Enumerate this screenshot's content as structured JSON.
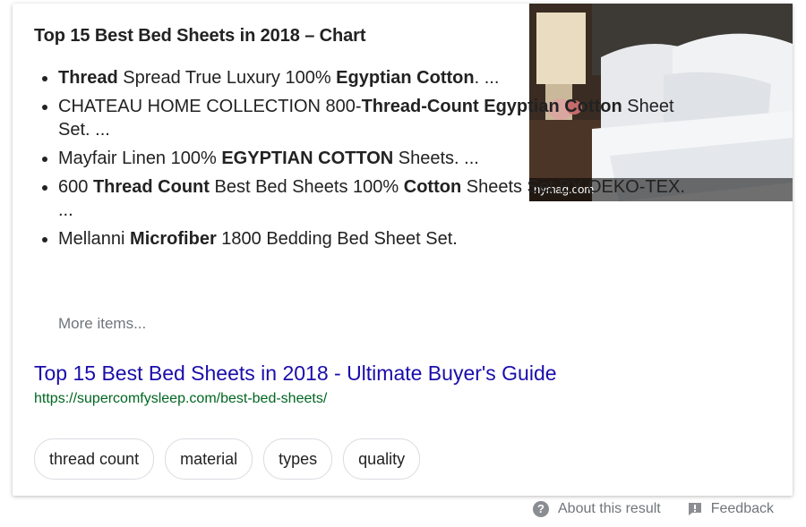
{
  "card": {
    "title": "Top 15 Best Bed Sheets in 2018 – Chart",
    "image_caption": "nymag.com",
    "list": [
      {
        "segments": [
          {
            "t": "Thread",
            "b": true
          },
          {
            "t": " Spread True Luxury 100% ",
            "b": false
          },
          {
            "t": "Egyptian Cotton",
            "b": true
          },
          {
            "t": ". ...",
            "b": false
          }
        ]
      },
      {
        "segments": [
          {
            "t": "CHATEAU HOME COLLECTION 800-",
            "b": false
          },
          {
            "t": "Thread-Count Egyptian Cotton",
            "b": true
          },
          {
            "t": " Sheet Set. ...",
            "b": false
          }
        ]
      },
      {
        "segments": [
          {
            "t": "Mayfair Linen 100% ",
            "b": false
          },
          {
            "t": "EGYPTIAN COTTON",
            "b": true
          },
          {
            "t": " Sheets. ...",
            "b": false
          }
        ]
      },
      {
        "segments": [
          {
            "t": "600 ",
            "b": false
          },
          {
            "t": "Thread Count",
            "b": true
          },
          {
            "t": " Best Bed Sheets 100% ",
            "b": false
          },
          {
            "t": "Cotton",
            "b": true
          },
          {
            "t": " Sheets Set BY OEKO-TEX. ...",
            "b": false
          }
        ]
      },
      {
        "segments": [
          {
            "t": "Mellanni ",
            "b": false
          },
          {
            "t": "Microfiber",
            "b": true
          },
          {
            "t": " 1800 Bedding Bed Sheet Set.",
            "b": false
          }
        ]
      }
    ],
    "more_items": "More items...",
    "link_title": "Top 15 Best Bed Sheets in 2018 - Ultimate Buyer's Guide",
    "link_url": "https://supercomfysleep.com/best-bed-sheets/",
    "chips": [
      "thread count",
      "material",
      "types",
      "quality"
    ]
  },
  "footer": {
    "about": "About this result",
    "feedback": "Feedback"
  },
  "colors": {
    "link": "#1a0dab",
    "url": "#006621",
    "muted": "#70757a"
  },
  "icons": {
    "about": "question-circle-icon",
    "feedback": "feedback-flag-icon"
  }
}
